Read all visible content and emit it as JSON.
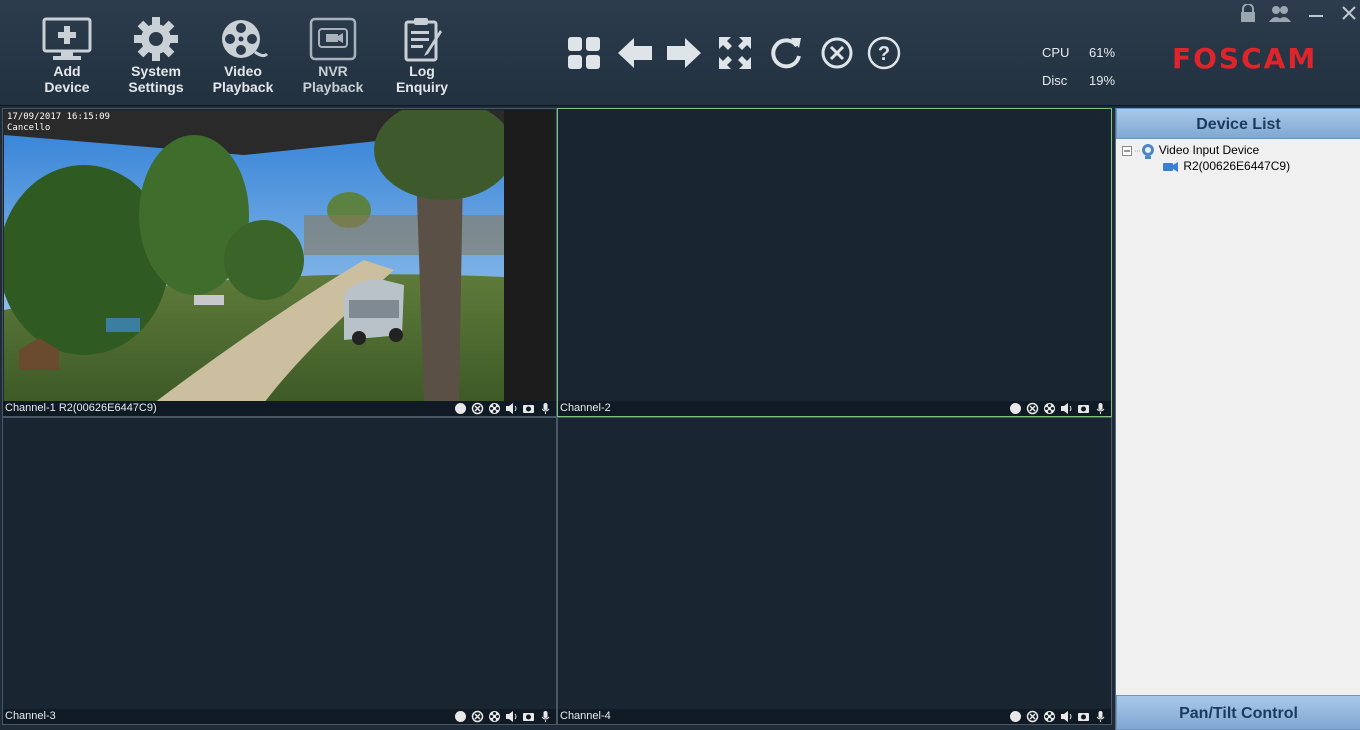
{
  "toolbar": {
    "items": [
      {
        "line1": "Add",
        "line2": "Device",
        "icon": "monitor-plus-icon"
      },
      {
        "line1": "System",
        "line2": "Settings",
        "icon": "gear-icon"
      },
      {
        "line1": "Video",
        "line2": "Playback",
        "icon": "film-reel-icon"
      },
      {
        "line1": "NVR",
        "line2": "Playback",
        "icon": "nvr-box-icon"
      },
      {
        "line1": "Log",
        "line2": "Enquiry",
        "icon": "clipboard-icon"
      }
    ],
    "center_icons": [
      "grid-layout-icon",
      "arrow-left-icon",
      "arrow-right-icon",
      "fullscreen-icon",
      "refresh-icon",
      "close-circle-icon",
      "help-icon"
    ]
  },
  "stats": {
    "cpu_label": "CPU",
    "cpu_value": "61%",
    "disc_label": "Disc",
    "disc_value": "19%"
  },
  "brand": {
    "logo": "FOSCAM",
    "color": "#e0242b"
  },
  "window_controls": [
    "lock-icon",
    "users-icon",
    "minimize-icon",
    "close-icon"
  ],
  "channels": [
    {
      "label": "Channel-1  R2(00626E6447C9)",
      "has_video": true,
      "osd_line1": "17/09/2017 16:15:09",
      "osd_line2": "Cancello"
    },
    {
      "label": "Channel-2",
      "has_video": false
    },
    {
      "label": "Channel-3",
      "has_video": false
    },
    {
      "label": "Channel-4",
      "has_video": false
    }
  ],
  "channel_bar_icons": [
    "record-dot-icon",
    "stop-icon",
    "ptz-icon",
    "speaker-icon",
    "snapshot-icon",
    "microphone-icon"
  ],
  "side": {
    "device_list_title": "Device List",
    "tree_root": "Video Input Device",
    "tree_child": "R2(00626E6447C9)",
    "ptz_title": "Pan/Tilt Control"
  },
  "colors": {
    "accent": "#7fc27f",
    "toolbar_bg": "#26364a",
    "panel_head": "#8fb4da"
  }
}
